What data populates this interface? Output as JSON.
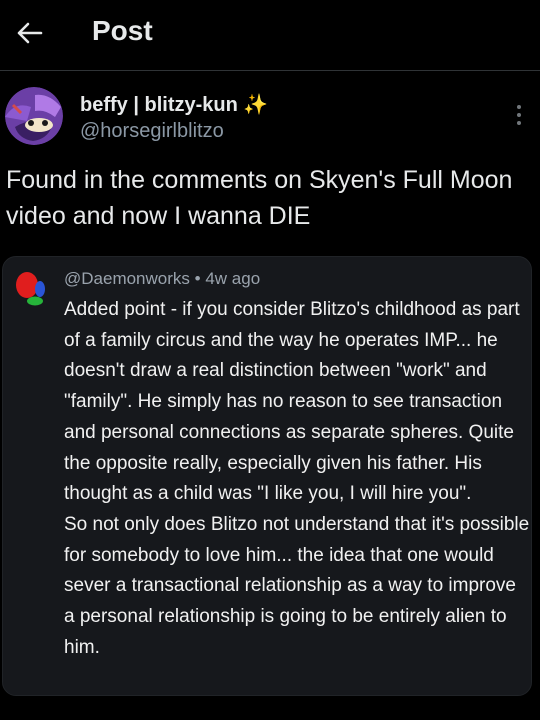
{
  "header": {
    "title": "Post",
    "back_icon": "arrow-left-icon"
  },
  "post": {
    "author_name": "beffy | blitzy-kun",
    "author_emoji": "✨",
    "author_handle": "@horsegirlblitzo",
    "text": "Found in the comments on Skyen's Full Moon video and now I wanna DIE",
    "more_icon": "vertical-dots-icon"
  },
  "comment": {
    "username": "@Daemonworks",
    "separator": "•",
    "time": "4w ago",
    "paragraph1": "Added point - if you consider Blitzo's childhood as part of a family circus and the way he operates IMP... he doesn't draw a real distinction between \"work\" and \"family\". He simply has no reason to see transaction and personal connections as separate spheres. Quite the opposite really, especially given his father. His thought as a child was \"I like you, I will hire you\".",
    "paragraph2": "So not only does Blitzo not understand that it's possible for somebody to love him... the idea that one would sever a transactional relationship as a way to improve a personal relationship is going to be entirely alien to him."
  },
  "colors": {
    "background": "#000000",
    "card": "#16181c",
    "text": "#e7e9ea",
    "muted": "#8b98a5",
    "sparkle": "#f5c518"
  }
}
